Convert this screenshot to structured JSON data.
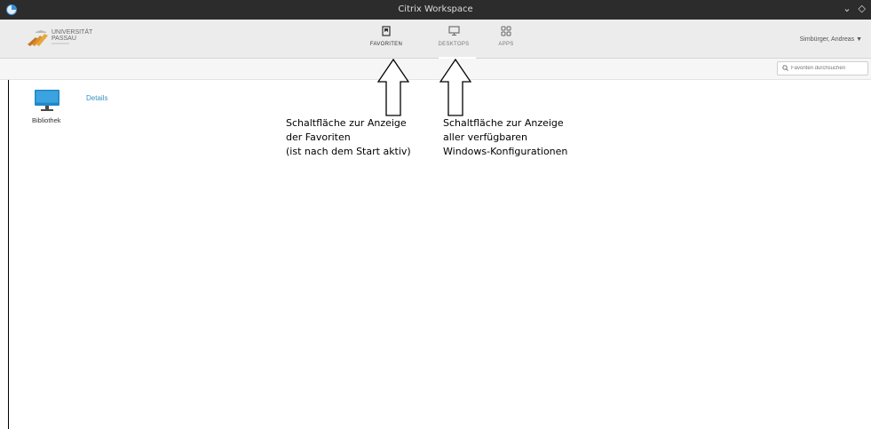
{
  "window": {
    "title": "Citrix Workspace"
  },
  "header": {
    "logo": {
      "name_line1": "UNIVERSITÄT",
      "name_line2": "PASSAU"
    },
    "tabs": [
      {
        "label": "FAVORITEN",
        "icon": "bookmark-icon",
        "active": true
      },
      {
        "label": "DESKTOPS",
        "icon": "monitor-icon",
        "active": false
      },
      {
        "label": "APPS",
        "icon": "grid-icon",
        "active": false
      }
    ],
    "user": "Simbürger, Andreas ▼"
  },
  "search": {
    "placeholder": "Favoriten durchsuchen"
  },
  "favorites": [
    {
      "name": "Bibliothek",
      "icon": "monitor-icon",
      "details_label": "Details"
    }
  ],
  "annotations": [
    {
      "lines": [
        "Schaltfläche zur Anzeige",
        "der Favoriten",
        "(ist nach dem Start aktiv)"
      ]
    },
    {
      "lines": [
        "Schaltfläche zur Anzeige",
        "aller verfügbaren",
        "Windows-Konfigurationen"
      ]
    }
  ],
  "colors": {
    "titlebar": "#2c2c2c",
    "navbar": "#ececec",
    "link": "#3a91c5",
    "desktop_icon": "#1e88c8"
  }
}
